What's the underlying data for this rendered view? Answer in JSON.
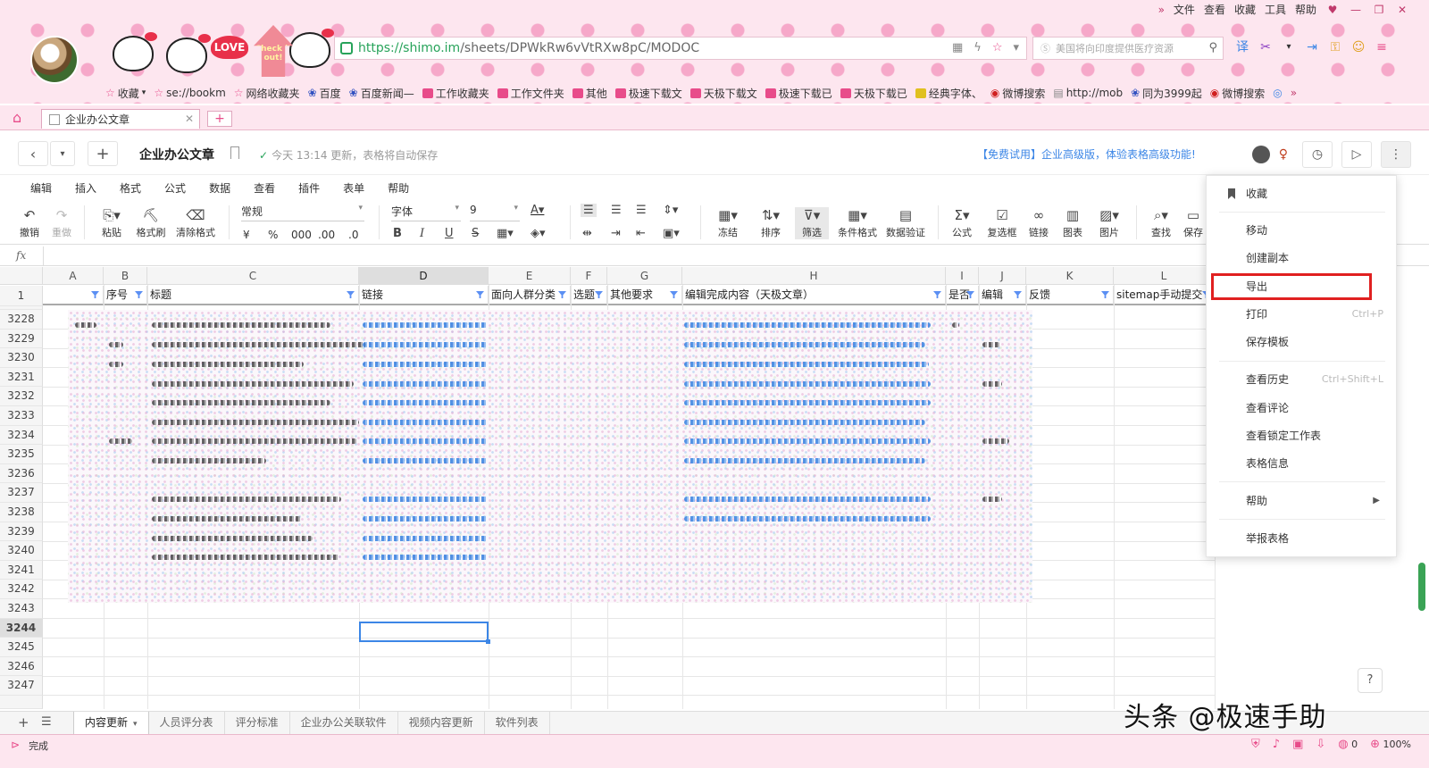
{
  "browser": {
    "menu": [
      "文件",
      "查看",
      "收藏",
      "工具",
      "帮助"
    ],
    "url_host": "https://shimo.im",
    "url_path": "/sheets/DPWkRw6vVtRXw8pC/MODOC",
    "search_placeholder": "美国将向印度提供医疗资源",
    "decor_love": "LOVE",
    "decor_checkout": "Check it out!",
    "bookmarks": [
      "收藏",
      "se://bookm",
      "网络收藏夹",
      "百度",
      "百度新闻—",
      "工作收藏夹",
      "工作文件夹",
      "其他",
      "极速下载文",
      "天极下载文",
      "极速下载已",
      "天极下载已",
      "经典字体、",
      "微博搜索",
      "http://mob",
      "同为3999起",
      "微博搜索"
    ],
    "tab_title": "企业办公文章",
    "status_text": "完成",
    "status_count": "0",
    "zoom": "100%"
  },
  "header": {
    "doc_title": "企业办公文章",
    "save_status": "今天 13:14 更新，表格将自动保存",
    "promo": "【免费试用】企业高级版，体验表格高级功能!"
  },
  "menubar": [
    "编辑",
    "插入",
    "格式",
    "公式",
    "数据",
    "查看",
    "插件",
    "表单",
    "帮助"
  ],
  "ribbon": {
    "undo": "撤销",
    "redo": "重做",
    "paste": "粘贴",
    "format_painter": "格式刷",
    "clear_format": "清除格式",
    "number_format": "常规",
    "percent": "%",
    "thousands": "000",
    "dec_dec": ".00",
    "dec_inc": ".0",
    "currency": "¥",
    "font": "字体",
    "font_size": "9",
    "freeze": "冻结",
    "sort": "排序",
    "filter": "筛选",
    "cond_format": "条件格式",
    "data_validation": "数据验证",
    "formula": "公式",
    "checkbox": "复选框",
    "link": "链接",
    "chart": "图表",
    "image": "图片",
    "find": "查找",
    "save": "保存"
  },
  "fx_label": "fx",
  "columns": [
    "A",
    "B",
    "C",
    "D",
    "E",
    "F",
    "G",
    "H",
    "I",
    "J",
    "K",
    "L"
  ],
  "header_row_num": "1",
  "header_row": [
    "",
    "序号",
    "标题",
    "链接",
    "面向人群分类",
    "选题",
    "其他要求",
    "编辑完成内容（天极文章）",
    "是否",
    "编辑",
    "反馈",
    "sitemap手动提交"
  ],
  "row_numbers": [
    "3228",
    "3229",
    "3230",
    "3231",
    "3232",
    "3233",
    "3234",
    "3235",
    "3236",
    "3237",
    "3238",
    "3239",
    "3240",
    "3241",
    "3242",
    "3243",
    "3244",
    "3245",
    "3246",
    "3247"
  ],
  "selected_row": "3244",
  "sheet_tabs": [
    "内容更新",
    "人员评分表",
    "评分标准",
    "企业办公关联软件",
    "视频内容更新",
    "软件列表"
  ],
  "dropdown": {
    "bookmark": "收藏",
    "move": "移动",
    "duplicate": "创建副本",
    "export": "导出",
    "print": "打印",
    "print_sc": "Ctrl+P",
    "save_template": "保存模板",
    "history": "查看历史",
    "history_sc": "Ctrl+Shift+L",
    "comments": "查看评论",
    "locked": "查看锁定工作表",
    "info": "表格信息",
    "help": "帮助",
    "report": "举报表格"
  },
  "watermark": "头条 @极速手助"
}
